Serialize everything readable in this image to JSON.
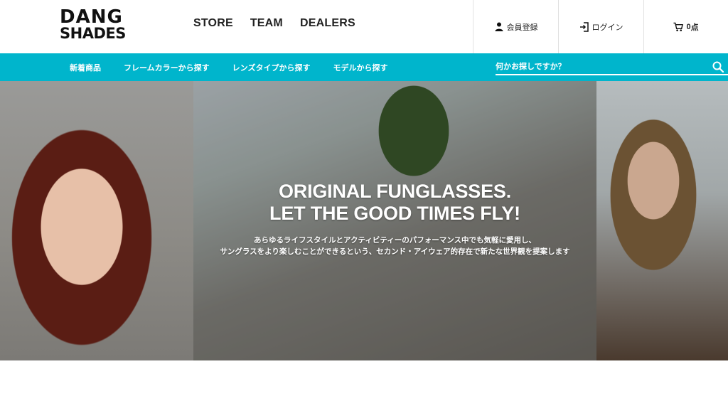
{
  "brand": {
    "logo_line1": "DANG",
    "logo_line2": "SHADES"
  },
  "main_nav": [
    {
      "label": "STORE"
    },
    {
      "label": "TEAM"
    },
    {
      "label": "DEALERS"
    }
  ],
  "utility": {
    "register_label": "会員登録",
    "login_label": "ログイン",
    "cart_count": "0",
    "cart_unit": "点"
  },
  "sub_nav": [
    {
      "label": "新着商品"
    },
    {
      "label": "フレームカラーから探す"
    },
    {
      "label": "レンズタイプから探す"
    },
    {
      "label": "モデルから探す"
    }
  ],
  "search": {
    "placeholder": "何かお探しですか？"
  },
  "hero": {
    "title_line1": "ORIGINAL FUNGLASSES.",
    "title_line2": "LET THE GOOD TIMES FLY!",
    "sub_line1": "あらゆるライフスタイルとアクティビティーのパフォーマンス中でも気軽に愛用し、",
    "sub_line2": "サングラスをより楽しむことができるという、セカンド・アイウェア的存在で新たな世界観を提案します"
  },
  "colors": {
    "accent": "#00b5cc",
    "text": "#222222"
  },
  "icons": {
    "register": "person-icon",
    "login": "login-icon",
    "cart": "cart-icon",
    "search": "search-icon"
  }
}
